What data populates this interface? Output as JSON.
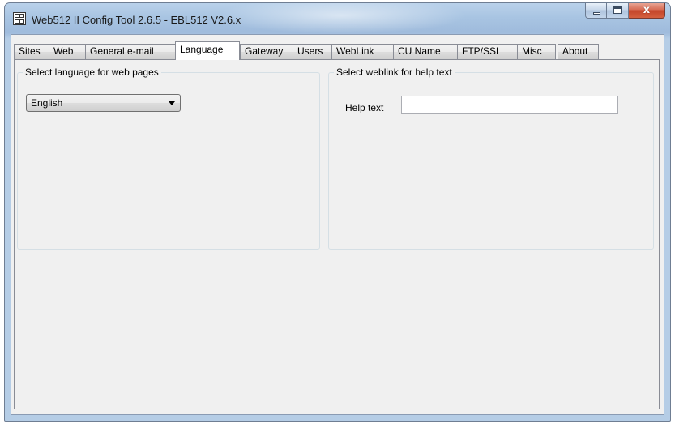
{
  "window": {
    "title": "Web512 II Config Tool 2.6.5 - EBL512 V2.6.x",
    "close_glyph": "x"
  },
  "tabs": [
    {
      "label": "Sites",
      "active": false
    },
    {
      "label": "Web",
      "active": false
    },
    {
      "label": "General e-mail",
      "active": false
    },
    {
      "label": "Language",
      "active": true
    },
    {
      "label": "Gateway",
      "active": false
    },
    {
      "label": "Users",
      "active": false
    },
    {
      "label": "WebLink",
      "active": false
    },
    {
      "label": "CU Name",
      "active": false
    },
    {
      "label": "FTP/SSL",
      "active": false
    },
    {
      "label": "Misc",
      "active": false
    },
    {
      "label": "About",
      "active": false
    }
  ],
  "language_group": {
    "title": "Select language for web pages",
    "selected_language": "English"
  },
  "weblink_group": {
    "title": "Select weblink for help text",
    "help_text_label": "Help text",
    "help_text_value": ""
  },
  "colors": {
    "titlebar": "#b9d1ea",
    "client_background": "#f0f0f0",
    "close_button": "#c4452a"
  },
  "icons": {
    "app": "app-icon",
    "minimize": "minimize-icon",
    "maximize": "maximize-icon",
    "close": "close-icon",
    "dropdown": "chevron-down-icon"
  }
}
